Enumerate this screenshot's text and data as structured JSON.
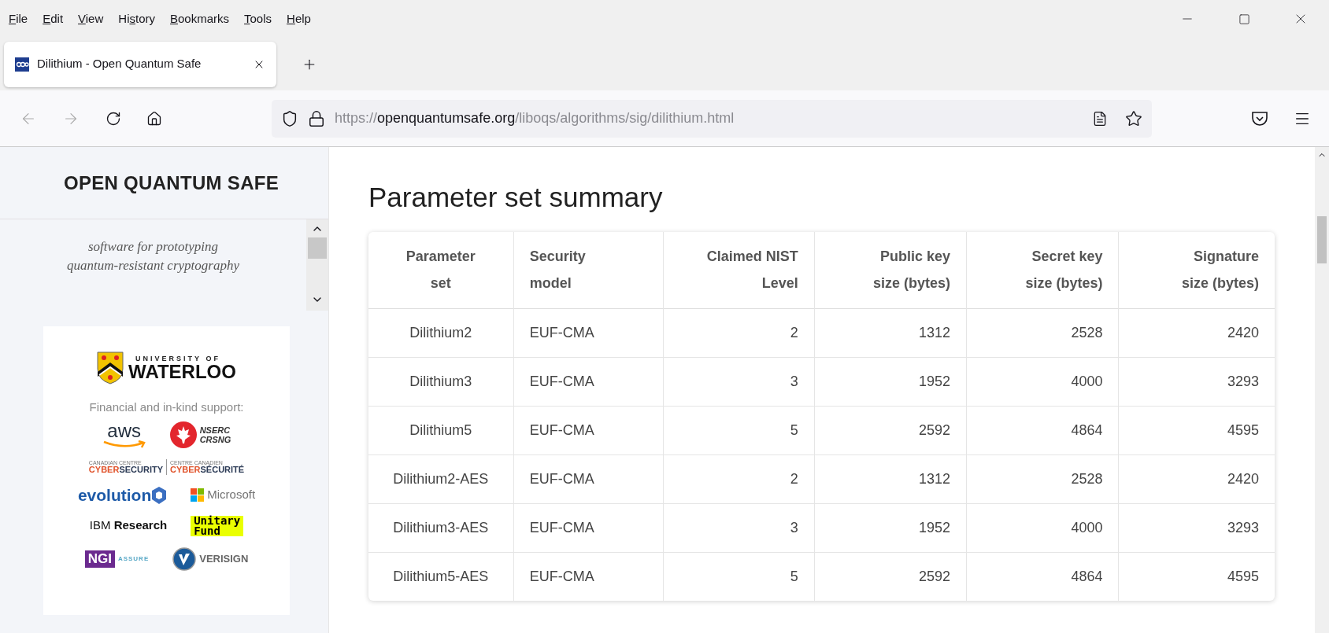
{
  "menu": [
    {
      "access_key": "F",
      "rest": "ile"
    },
    {
      "access_key": "E",
      "rest": "dit"
    },
    {
      "access_key": "V",
      "rest": "iew"
    },
    {
      "prefix": "Hi",
      "access_key": "s",
      "rest": "tory"
    },
    {
      "access_key": "B",
      "rest": "ookmarks"
    },
    {
      "access_key": "T",
      "rest": "ools"
    },
    {
      "access_key": "H",
      "rest": "elp"
    }
  ],
  "tabs": [
    {
      "title": "Dilithium - Open Quantum Safe",
      "selected": true
    }
  ],
  "address_bar": {
    "scheme": "https://",
    "domain": "openquantumsafe.org",
    "path": "/liboqs/algorithms/sig/dilithium.html"
  },
  "sidebar": {
    "title": "OPEN QUANTUM SAFE",
    "tagline": [
      "software for prototyping",
      "quantum-resistant cryptography"
    ],
    "university": {
      "line_1": "UNIVERSITY OF",
      "line_2": "WATERLOO"
    },
    "support_label": "Financial and in-kind support:",
    "sponsor_rows": [
      [
        {
          "kind": "aws",
          "texts": [
            "aws"
          ]
        },
        {
          "kind": "nserc",
          "texts": [
            "NSERC",
            "CRSNG"
          ]
        }
      ],
      [
        {
          "kind": "cyber",
          "texts": [
            "CANADIAN CENTRE",
            "CYBER",
            "SECURITY",
            "CENTRE CANADIEN",
            "CYBER",
            "SÉCURITÉ"
          ]
        }
      ],
      [
        {
          "kind": "evolution",
          "texts": [
            "evolution"
          ]
        },
        {
          "kind": "microsoft",
          "texts": [
            "Microsoft"
          ]
        }
      ],
      [
        {
          "kind": "ibm",
          "texts": [
            "IBM",
            "Research"
          ]
        },
        {
          "kind": "unitary",
          "texts": [
            "Unitary",
            "Fund"
          ]
        }
      ],
      [
        {
          "kind": "ngi",
          "texts": [
            "NGI",
            "ASSURE"
          ]
        },
        {
          "kind": "verisign",
          "texts": [
            "VERISIGN"
          ]
        }
      ]
    ]
  },
  "main": {
    "heading": "Parameter set summary",
    "table": {
      "columns": [
        "Parameter\nset",
        "Security\nmodel",
        "Claimed NIST\nLevel",
        "Public key\nsize (bytes)",
        "Secret key\nsize (bytes)",
        "Signature\nsize (bytes)"
      ],
      "rows": [
        [
          "Dilithium2",
          "EUF-CMA",
          "2",
          "1312",
          "2528",
          "2420"
        ],
        [
          "Dilithium3",
          "EUF-CMA",
          "3",
          "1952",
          "4000",
          "3293"
        ],
        [
          "Dilithium5",
          "EUF-CMA",
          "5",
          "2592",
          "4864",
          "4595"
        ],
        [
          "Dilithium2-AES",
          "EUF-CMA",
          "2",
          "1312",
          "2528",
          "2420"
        ],
        [
          "Dilithium3-AES",
          "EUF-CMA",
          "3",
          "1952",
          "4000",
          "3293"
        ],
        [
          "Dilithium5-AES",
          "EUF-CMA",
          "5",
          "2592",
          "4864",
          "4595"
        ]
      ]
    }
  }
}
